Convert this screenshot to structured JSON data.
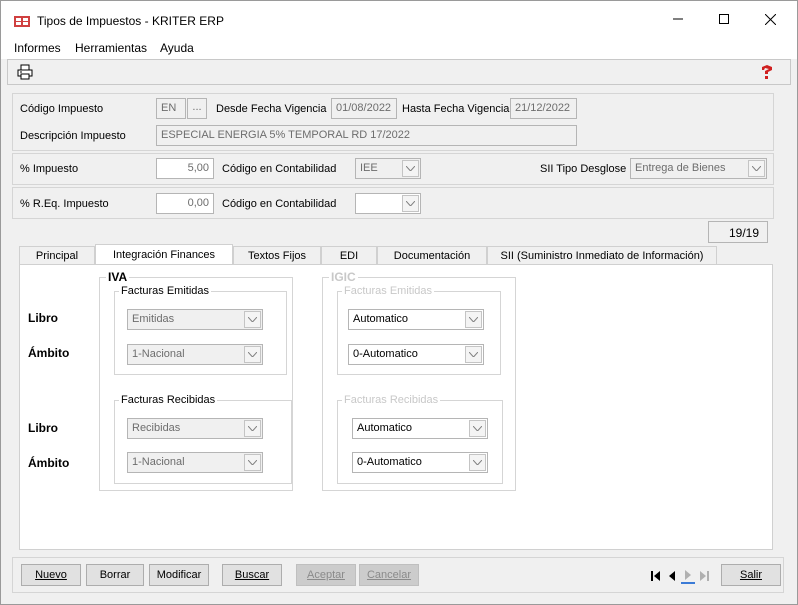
{
  "window": {
    "title": "Tipos de Impuestos - KRITER ERP"
  },
  "menu": {
    "items": [
      "Informes",
      "Herramientas",
      "Ayuda"
    ]
  },
  "toolbar": {
    "print_icon": "printer-icon",
    "help_icon": "help-icon"
  },
  "form": {
    "codigo_label": "Código Impuesto",
    "codigo_value": "EN",
    "codigo_lookup": "...",
    "desde_label": "Desde Fecha Vigencia",
    "desde_value": "01/08/2022",
    "hasta_label": "Hasta Fecha Vigencia",
    "hasta_value": "21/12/2022",
    "descripcion_label": "Descripción Impuesto",
    "descripcion_value": "ESPECIAL ENERGIA 5% TEMPORAL RD 17/2022",
    "pct_label": "% Impuesto",
    "pct_value": "5,00",
    "contab_label": "Código en Contabilidad",
    "contab_value": "IEE",
    "sii_label": "SII Tipo Desglose",
    "sii_value": "Entrega de Bienes",
    "req_label": "% R.Eq. Impuesto",
    "req_value": "0,00",
    "contab2_label": "Código en Contabilidad",
    "contab2_value": ""
  },
  "counter": "19/19",
  "tabs": [
    {
      "label": "Principal"
    },
    {
      "label": "Integración Finances"
    },
    {
      "label": "Textos Fijos"
    },
    {
      "label": "EDI"
    },
    {
      "label": "Documentación"
    },
    {
      "label": "SII (Suministro Inmediato de Información)"
    }
  ],
  "integracion": {
    "libro_label": "Libro",
    "ambito_label": "Ámbito",
    "iva_title": "IVA",
    "igic_title": "IGIC",
    "emitidas_title": "Facturas Emitidas",
    "recibidas_title": "Facturas Recibidas",
    "iva_emitidas_libro": "Emitidas",
    "iva_emitidas_ambito": "1-Nacional",
    "iva_recibidas_libro": "Recibidas",
    "iva_recibidas_ambito": "1-Nacional",
    "igic_emitidas_libro": "Automatico",
    "igic_emitidas_ambito": "0-Automatico",
    "igic_recibidas_libro": "Automatico",
    "igic_recibidas_ambito": "0-Automatico"
  },
  "buttons": {
    "nuevo": "Nuevo",
    "borrar": "Borrar",
    "modificar": "Modificar",
    "buscar": "Buscar",
    "aceptar": "Aceptar",
    "cancelar": "Cancelar",
    "salir": "Salir"
  }
}
